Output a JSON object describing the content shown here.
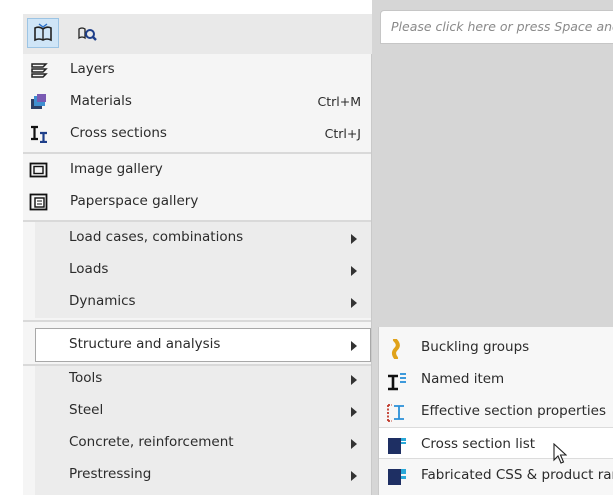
{
  "search": {
    "placeholder": "Please click here or press Space and type"
  },
  "toolbar": {
    "buttons": [
      {
        "icon": "book-tree-icon",
        "active": true
      },
      {
        "icon": "search-tree-icon",
        "active": false
      }
    ]
  },
  "menu": {
    "items": [
      {
        "label": "Layers",
        "icon": "layers-icon",
        "shortcut": ""
      },
      {
        "label": "Materials",
        "icon": "materials-icon",
        "shortcut": "Ctrl+M"
      },
      {
        "label": "Cross sections",
        "icon": "cross-section-icon",
        "shortcut": "Ctrl+J"
      },
      {
        "label": "Image gallery",
        "icon": "image-gallery-icon",
        "shortcut": ""
      },
      {
        "label": "Paperspace gallery",
        "icon": "paperspace-gallery-icon",
        "shortcut": ""
      },
      {
        "label": "Load cases, combinations",
        "submenu": true
      },
      {
        "label": "Loads",
        "submenu": true
      },
      {
        "label": "Dynamics",
        "submenu": true
      },
      {
        "label": "Structure and analysis",
        "submenu": true,
        "selected": true
      },
      {
        "label": "Tools",
        "submenu": true
      },
      {
        "label": "Steel",
        "submenu": true
      },
      {
        "label": "Concrete, reinforcement",
        "submenu": true
      },
      {
        "label": "Prestressing",
        "submenu": true
      }
    ]
  },
  "submenu": {
    "items": [
      {
        "label": "Buckling groups",
        "icon": "buckling-groups-icon"
      },
      {
        "label": "Named item",
        "icon": "named-item-icon"
      },
      {
        "label": "Effective section properties",
        "icon": "effective-section-icon"
      },
      {
        "label": "Cross section list",
        "icon": "cross-section-list-icon",
        "hover": true
      },
      {
        "label": "Fabricated CSS & product range",
        "icon": "fabricated-css-icon"
      }
    ]
  },
  "colors": {
    "accent": "#1e3f8a",
    "hover_bg": "#ffffff",
    "menu_bg": "#f5f5f5"
  }
}
